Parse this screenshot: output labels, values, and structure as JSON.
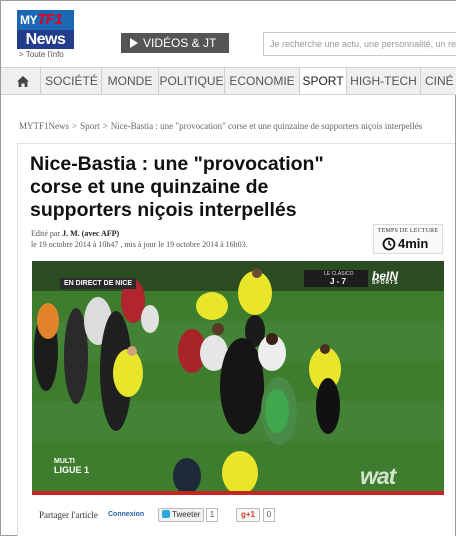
{
  "header": {
    "logo_top": "MY",
    "logo_top_brand": "TF1",
    "logo_main": "News",
    "logo_tagline": "> Toute l'info",
    "videos_button": "VIDÉOS & JT",
    "search_placeholder": "Je recherche une actu, une personnalité, un rep"
  },
  "nav": {
    "items": [
      "SOCIÉTÉ",
      "MONDE",
      "POLITIQUE",
      "ECONOMIE",
      "SPORT",
      "HIGH-TECH",
      "CINÉ"
    ],
    "active": "SPORT"
  },
  "breadcrumb": {
    "items": [
      "MYTF1News",
      "Sport",
      "Nice-Bastia : une \"provocation\" corse et une quinzaine de supporters niçois interpellés"
    ],
    "separator": ">"
  },
  "article": {
    "title": "Nice-Bastia : une \"provocation\" corse et une quinzaine de supporters niçois interpellés",
    "byline_prefix": "Edité par",
    "author": "J. M. (avec AFP)",
    "dates": "le 19 octobre 2014 à 10h47 , mis à jour le 19 octobre 2014 à 16h03.",
    "reading_time_label": "TEMPS DE LECTURE",
    "reading_time_value": "4min"
  },
  "video": {
    "live_banner": "EN DIRECT DE NICE",
    "score_label": "LE CLASICO",
    "score_value": "J - 7",
    "channel": "beIN",
    "channel_sub": "SPORTS",
    "competition_top": "MULTI",
    "competition_main": "LIGUE 1",
    "watermark": "wat"
  },
  "share": {
    "label": "Partager l'article",
    "connexion": "Connexion",
    "tweet_button": "Tweeter",
    "tweet_count": "1",
    "gplus_button": "g+1",
    "gplus_count": "0"
  },
  "colors": {
    "logo_blue": "#1a67b3",
    "logo_red": "#e2001a",
    "video_progress": "#c2261e",
    "pitch_green": "#3f7d2e",
    "steward_vest": "#e8e52b"
  },
  "icons": [
    "home-icon",
    "play-icon",
    "clock-icon",
    "twitter-icon"
  ]
}
